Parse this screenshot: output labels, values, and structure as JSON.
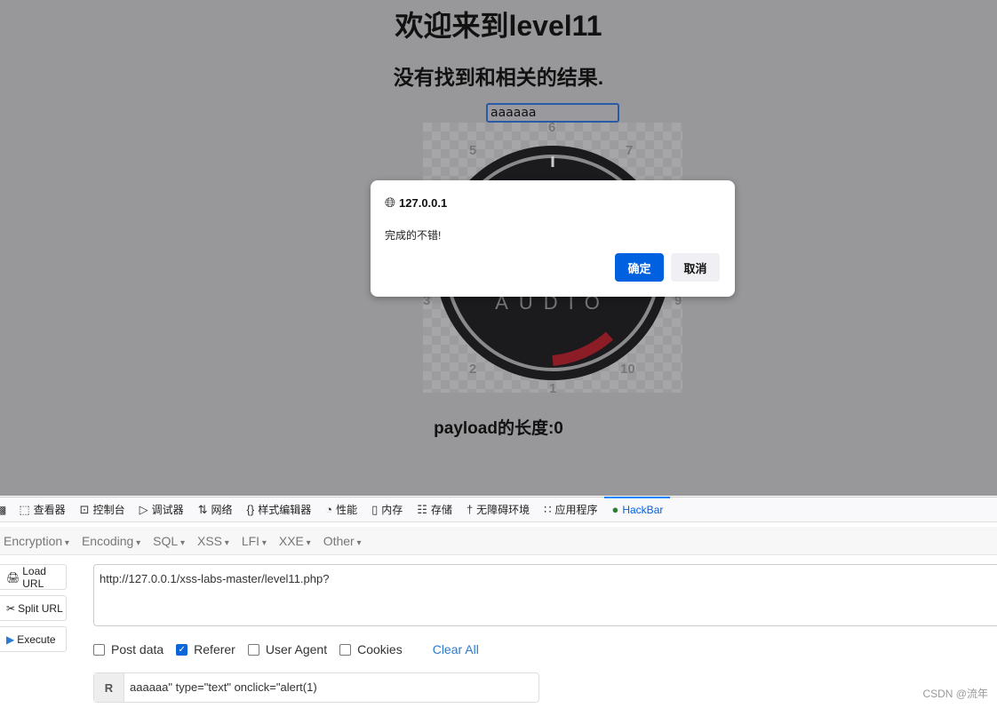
{
  "page": {
    "title": "欢迎来到level11",
    "result": "没有找到和相关的结果.",
    "search_value": "aaaaaa",
    "payload_length": "payload的长度:0",
    "gauge": {
      "brand": "AUDIO",
      "labels": [
        "1",
        "2",
        "3",
        "5",
        "6",
        "7",
        "9",
        "10"
      ]
    }
  },
  "dialog": {
    "host": "127.0.0.1",
    "message": "完成的不错!",
    "ok_label": "确定",
    "cancel_label": "取消",
    "ok_color": "#0061e0"
  },
  "devtools": {
    "tabs": [
      {
        "icon": "inspector-icon",
        "label": "查看器"
      },
      {
        "icon": "console-icon",
        "label": "控制台"
      },
      {
        "icon": "debugger-icon",
        "label": "调试器"
      },
      {
        "icon": "network-icon",
        "label": "网络"
      },
      {
        "icon": "style-editor-icon",
        "label": "样式编辑器"
      },
      {
        "icon": "performance-icon",
        "label": "性能"
      },
      {
        "icon": "memory-icon",
        "label": "内存"
      },
      {
        "icon": "storage-icon",
        "label": "存储"
      },
      {
        "icon": "accessibility-icon",
        "label": "无障碍环境"
      },
      {
        "icon": "application-icon",
        "label": "应用程序"
      },
      {
        "icon": "hackbar-icon",
        "label": "HackBar"
      }
    ],
    "active": "HackBar"
  },
  "hackbar": {
    "menu": [
      "Encryption",
      "Encoding",
      "SQL",
      "XSS",
      "LFI",
      "XXE",
      "Other"
    ],
    "buttons": [
      "Load URL",
      "Split URL",
      "Execute"
    ],
    "url": "http://127.0.0.1/xss-labs-master/level11.php?",
    "options": [
      {
        "label": "Post data",
        "checked": false
      },
      {
        "label": "Referer",
        "checked": true
      },
      {
        "label": "User Agent",
        "checked": false
      },
      {
        "label": "Cookies",
        "checked": false
      }
    ],
    "clear_all": "Clear All",
    "referer_label": "R",
    "referer_value": "aaaaaa\" type=\"text\" onclick=\"alert(1)"
  },
  "watermark": "CSDN @流年"
}
